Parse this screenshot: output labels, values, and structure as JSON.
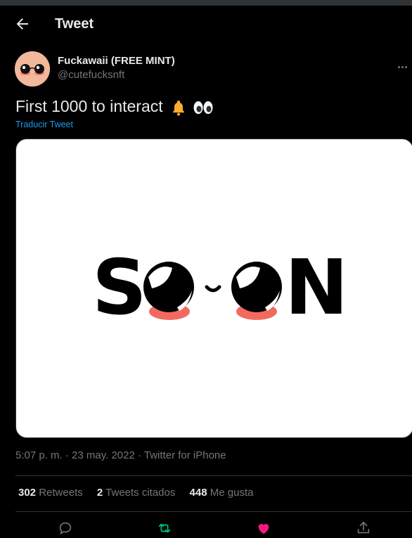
{
  "header": {
    "title": "Tweet"
  },
  "author": {
    "display_name": "Fuckawaii (FREE MINT)",
    "handle": "@cutefucksnft"
  },
  "tweet": {
    "text": "First 1000 to interact",
    "emojis": [
      "bell-emoji",
      "eyes-emoji"
    ],
    "translate_label": "Traducir Tweet",
    "image_text": "SOON"
  },
  "meta": {
    "time": "5:07 p. m.",
    "date": "23 may. 2022",
    "source": "Twitter for iPhone"
  },
  "stats": {
    "retweets_count": "302",
    "retweets_label": "Retweets",
    "quotes_count": "2",
    "quotes_label": "Tweets citados",
    "likes_count": "448",
    "likes_label": "Me gusta"
  },
  "colors": {
    "accent": "#1d9bf0",
    "retweet": "#00ba7c",
    "like": "#f91880",
    "background": "#000000"
  }
}
